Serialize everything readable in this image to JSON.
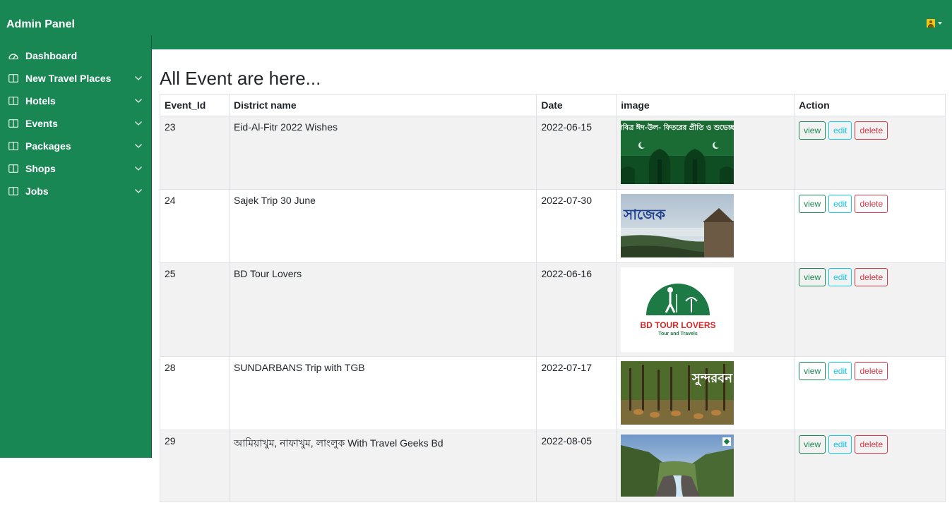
{
  "brand": "Admin Panel",
  "nav": [
    {
      "label": "Dashboard",
      "icon": "dashboard-icon",
      "expandable": false
    },
    {
      "label": "New Travel Places",
      "icon": "columns-icon",
      "expandable": true
    },
    {
      "label": "Hotels",
      "icon": "columns-icon",
      "expandable": true
    },
    {
      "label": "Events",
      "icon": "columns-icon",
      "expandable": true
    },
    {
      "label": "Packages",
      "icon": "columns-icon",
      "expandable": true
    },
    {
      "label": "Shops",
      "icon": "columns-icon",
      "expandable": true
    },
    {
      "label": "Jobs",
      "icon": "columns-icon",
      "expandable": true
    }
  ],
  "page_title": "All Event are here...",
  "table": {
    "headers": [
      "Event_Id",
      "District name",
      "Date",
      "image",
      "Action"
    ],
    "rows": [
      {
        "id": "23",
        "name": "Eid-Al-Fitr 2022 Wishes",
        "date": "2022-06-15",
        "image_text": "পবিত্র ঈদ-উল- ফিতরের প্রীতি ও শুভেচ্ছা"
      },
      {
        "id": "24",
        "name": "Sajek Trip 30 June",
        "date": "2022-07-30",
        "image_text": "সাজেক"
      },
      {
        "id": "25",
        "name": "BD Tour Lovers",
        "date": "2022-06-16",
        "image_text": "BD TOUR LOVERS",
        "image_subtext": "Tour and Travels"
      },
      {
        "id": "28",
        "name": "SUNDARBANS Trip with TGB",
        "date": "2022-07-17",
        "image_text": "সুন্দরবন"
      },
      {
        "id": "29",
        "name": "আমিয়াখুম, নাফাখুম, লাংলুক With Travel Geeks Bd",
        "date": "2022-08-05",
        "image_text": ""
      }
    ],
    "actions": {
      "view": "view",
      "edit": "edit",
      "delete": "delete"
    }
  },
  "colors": {
    "primary": "#198754",
    "info": "#0dcaf0",
    "danger": "#dc3545"
  }
}
